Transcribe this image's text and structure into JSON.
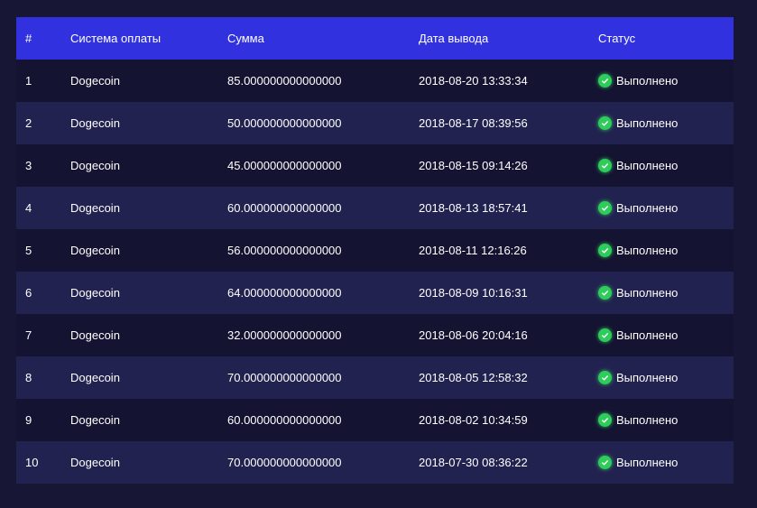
{
  "headers": [
    "#",
    "Система оплаты",
    "Сумма",
    "Дата вывода",
    "Статус"
  ],
  "rows": [
    {
      "n": "1",
      "system": "Dogecoin",
      "amount": "85.000000000000000",
      "date": "2018-08-20 13:33:34",
      "status": "Выполнено"
    },
    {
      "n": "2",
      "system": "Dogecoin",
      "amount": "50.000000000000000",
      "date": "2018-08-17 08:39:56",
      "status": "Выполнено"
    },
    {
      "n": "3",
      "system": "Dogecoin",
      "amount": "45.000000000000000",
      "date": "2018-08-15 09:14:26",
      "status": "Выполнено"
    },
    {
      "n": "4",
      "system": "Dogecoin",
      "amount": "60.000000000000000",
      "date": "2018-08-13 18:57:41",
      "status": "Выполнено"
    },
    {
      "n": "5",
      "system": "Dogecoin",
      "amount": "56.000000000000000",
      "date": "2018-08-11 12:16:26",
      "status": "Выполнено"
    },
    {
      "n": "6",
      "system": "Dogecoin",
      "amount": "64.000000000000000",
      "date": "2018-08-09 10:16:31",
      "status": "Выполнено"
    },
    {
      "n": "7",
      "system": "Dogecoin",
      "amount": "32.000000000000000",
      "date": "2018-08-06 20:04:16",
      "status": "Выполнено"
    },
    {
      "n": "8",
      "system": "Dogecoin",
      "amount": "70.000000000000000",
      "date": "2018-08-05 12:58:32",
      "status": "Выполнено"
    },
    {
      "n": "9",
      "system": "Dogecoin",
      "amount": "60.000000000000000",
      "date": "2018-08-02 10:34:59",
      "status": "Выполнено"
    },
    {
      "n": "10",
      "system": "Dogecoin",
      "amount": "70.000000000000000",
      "date": "2018-07-30 08:36:22",
      "status": "Выполнено"
    }
  ],
  "colors": {
    "header": "#3131e0",
    "success": "#2ecc5a"
  }
}
